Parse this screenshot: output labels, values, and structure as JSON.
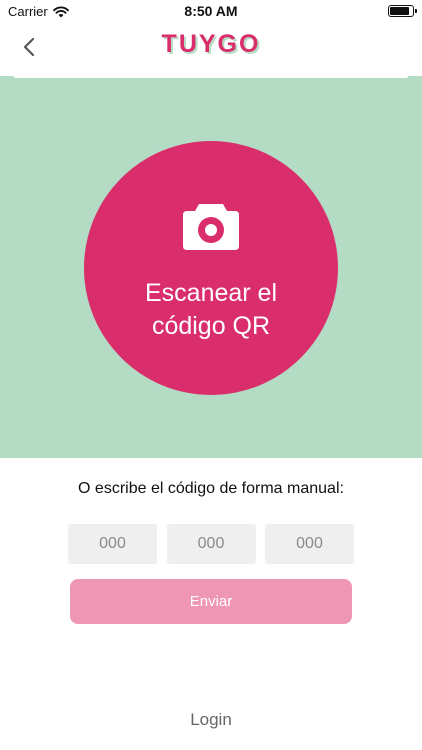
{
  "status_bar": {
    "carrier": "Carrier",
    "time": "8:50 AM"
  },
  "nav": {
    "logo": "TUYGO",
    "back_icon": "chevron-left-icon"
  },
  "scanner": {
    "label_line1": "Escanear el",
    "label_line2": "código QR",
    "icon": "camera-icon"
  },
  "manual": {
    "label": "O escribe el código de forma manual:",
    "inputs": [
      {
        "placeholder": "000",
        "value": ""
      },
      {
        "placeholder": "000",
        "value": ""
      },
      {
        "placeholder": "000",
        "value": ""
      }
    ],
    "send_label": "Enviar"
  },
  "footer": {
    "login_label": "Login"
  },
  "colors": {
    "brand_pink": "#d92e6b",
    "panel_green": "#b4dcc4",
    "button_disabled_pink": "#ee96b3",
    "input_bg": "#efefef"
  }
}
